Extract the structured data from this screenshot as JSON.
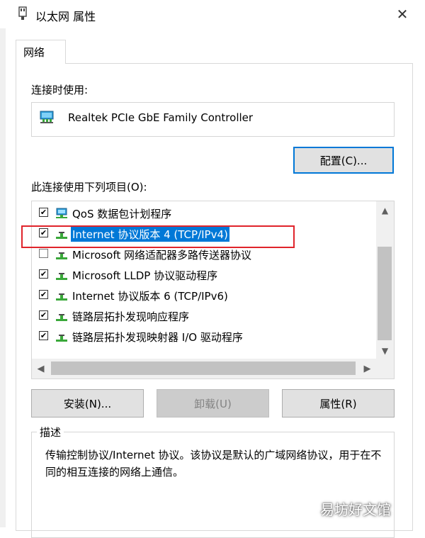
{
  "window": {
    "title": "以太网 属性"
  },
  "tabs": [
    {
      "label": "网络"
    }
  ],
  "connect_using": {
    "label": "连接时使用:",
    "adapter": "Realtek PCIe GbE Family Controller",
    "configure_button": "配置(C)..."
  },
  "items_section": {
    "label": "此连接使用下列项目(O):",
    "items": [
      {
        "label": "QoS 数据包计划程序",
        "checked": true,
        "selected": false,
        "icon": "qos-scheduler-icon"
      },
      {
        "label": "Internet 协议版本 4 (TCP/IPv4)",
        "checked": true,
        "selected": true,
        "icon": "network-protocol-icon"
      },
      {
        "label": "Microsoft 网络适配器多路传送器协议",
        "checked": false,
        "selected": false,
        "icon": "network-protocol-icon"
      },
      {
        "label": "Microsoft LLDP 协议驱动程序",
        "checked": true,
        "selected": false,
        "icon": "network-protocol-icon"
      },
      {
        "label": "Internet 协议版本 6 (TCP/IPv6)",
        "checked": true,
        "selected": false,
        "icon": "network-protocol-icon"
      },
      {
        "label": "链路层拓扑发现响应程序",
        "checked": true,
        "selected": false,
        "icon": "network-protocol-icon"
      },
      {
        "label": "链路层拓扑发现映射器 I/O 驱动程序",
        "checked": true,
        "selected": false,
        "icon": "network-protocol-icon"
      }
    ]
  },
  "buttons": {
    "install": "安装(N)...",
    "uninstall": "卸载(U)",
    "properties": "属性(R)"
  },
  "description": {
    "title": "描述",
    "text": "传输控制协议/Internet 协议。该协议是默认的广域网络协议，用于在不同的相互连接的网络上通信。"
  },
  "watermark": "易坊好文馆",
  "colors": {
    "selection": "#0078d7",
    "highlight_box": "#e0242b",
    "button_face": "#e1e1e1"
  }
}
